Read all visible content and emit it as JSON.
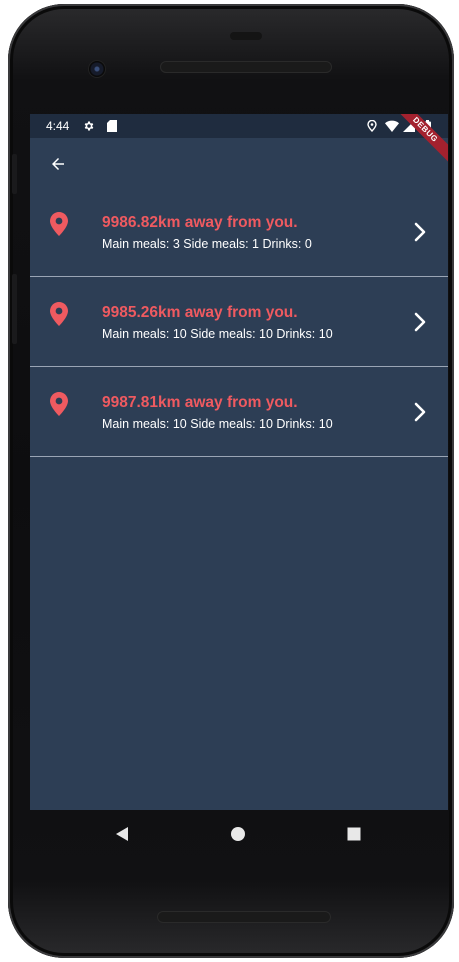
{
  "status_bar": {
    "time": "4:44",
    "debug_label": "DEBUG",
    "icons": [
      "settings-icon",
      "sd-card-icon",
      "location-icon",
      "wifi-icon",
      "signal-icon",
      "battery-icon"
    ]
  },
  "app_bar": {
    "back_icon": "arrow-back-icon"
  },
  "list": {
    "items": [
      {
        "title": "9986.82km away from you.",
        "subtitle": "Main meals: 3 Side meals: 1 Drinks: 0"
      },
      {
        "title": "9985.26km away from you.",
        "subtitle": "Main meals: 10 Side meals: 10 Drinks: 10"
      },
      {
        "title": "9987.81km away from you.",
        "subtitle": "Main meals: 10 Side meals: 10 Drinks: 10"
      }
    ]
  },
  "nav_bar": {
    "icons": [
      "back-triangle-icon",
      "home-circle-icon",
      "recents-square-icon"
    ]
  },
  "colors": {
    "background": "#2d3e55",
    "status_bar": "#1f2c3f",
    "accent": "#ef5a60",
    "text": "#ffffff",
    "divider": "#9aa5b5",
    "debug_banner": "#a3212e"
  }
}
